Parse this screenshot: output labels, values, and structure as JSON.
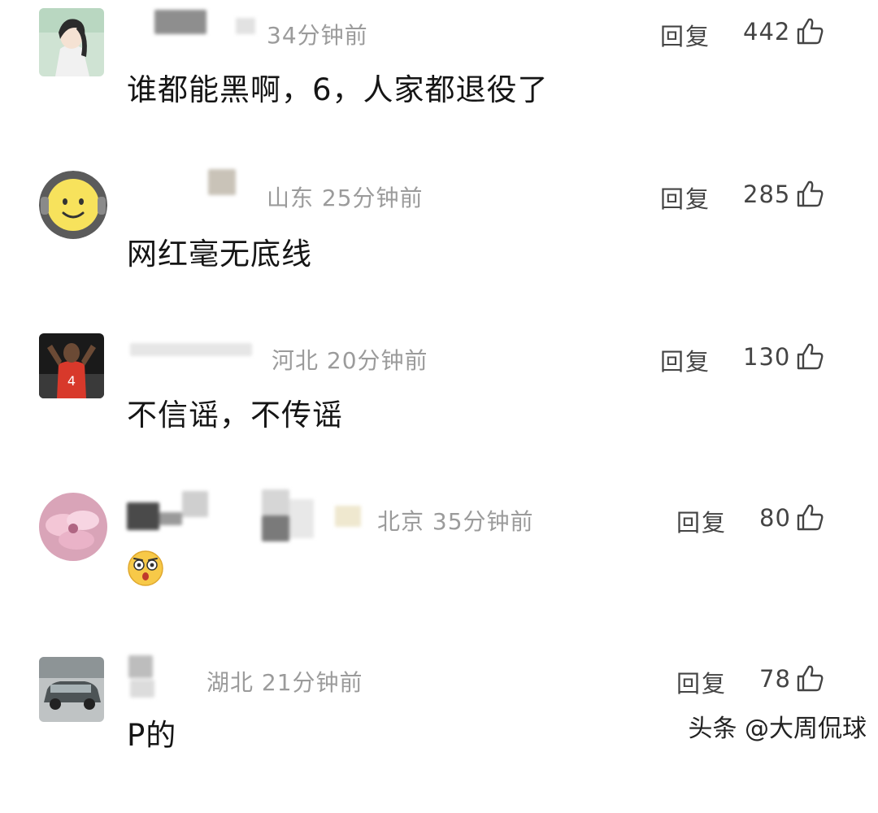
{
  "comments": [
    {
      "meta": "34分钟前",
      "reply": "回复",
      "likes": "442",
      "text": "谁都能黑啊，6，人家都退役了",
      "avatar": "anime-avatar"
    },
    {
      "meta": "山东 25分钟前",
      "reply": "回复",
      "likes": "285",
      "text": "网红毫无底线",
      "avatar": "smiley-avatar"
    },
    {
      "meta": "河北 20分钟前",
      "reply": "回复",
      "likes": "130",
      "text": "不信谣，不传谣",
      "avatar": "basketball-player-avatar"
    },
    {
      "meta": "北京 35分钟前",
      "reply": "回复",
      "likes": "80",
      "text": "",
      "emoji": "dizzy-face-emoji",
      "avatar": "flower-avatar"
    },
    {
      "meta": "湖北 21分钟前",
      "reply": "回复",
      "likes": "78",
      "text": "P的",
      "avatar": "car-avatar"
    }
  ],
  "watermark": "头条 @大周侃球",
  "colors": {
    "meta_gray": "#9b9b9b",
    "text_dark": "#151515",
    "smiley_yellow": "#f7e25c"
  }
}
